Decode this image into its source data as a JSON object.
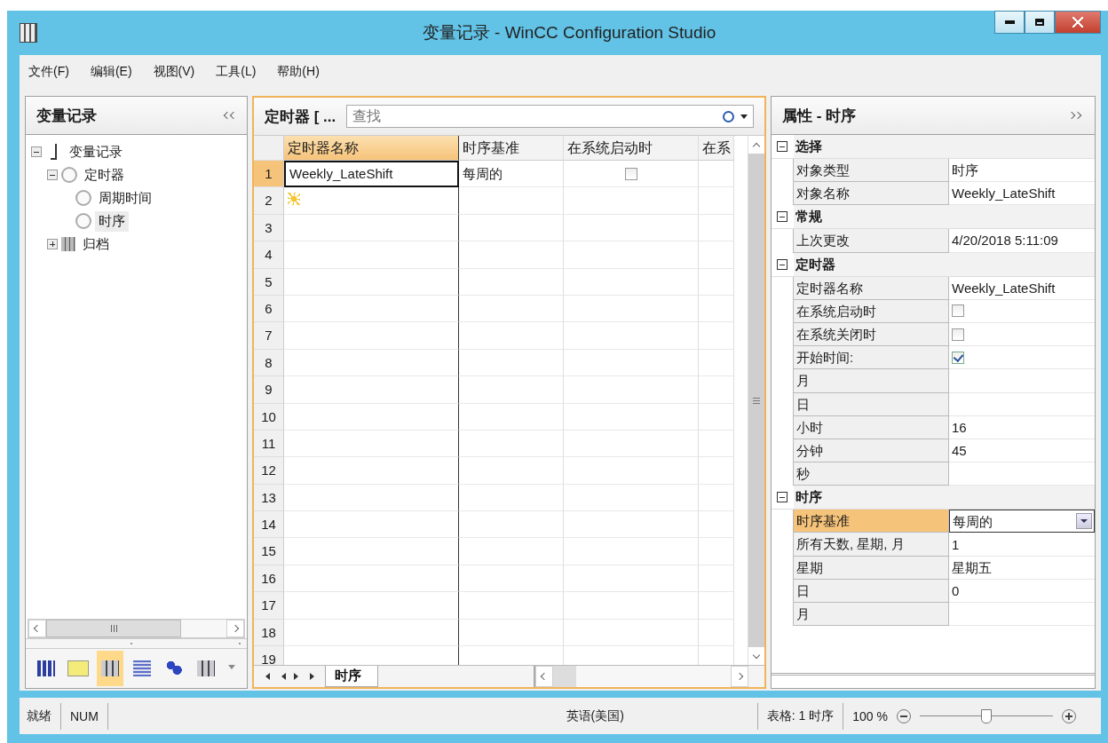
{
  "window": {
    "title": "变量记录 - WinCC Configuration Studio"
  },
  "menu": [
    "文件(F)",
    "编辑(E)",
    "视图(V)",
    "工具(L)",
    "帮助(H)"
  ],
  "navigator": {
    "title": "变量记录",
    "tree": [
      {
        "label": "变量记录",
        "kind": "root",
        "expanded": true,
        "selected": false,
        "children": [
          {
            "label": "定时器",
            "kind": "timer",
            "expanded": true,
            "selected": false,
            "children": [
              {
                "label": "周期时间",
                "kind": "timer",
                "selected": false
              },
              {
                "label": "时序",
                "kind": "timer",
                "selected": true
              }
            ]
          },
          {
            "label": "归档",
            "kind": "archive",
            "expanded": false,
            "selected": false
          }
        ]
      }
    ],
    "bottom_icons": [
      {
        "kind": "columns",
        "selected": false
      },
      {
        "kind": "mail",
        "selected": false
      },
      {
        "kind": "archive",
        "selected": true
      },
      {
        "kind": "table",
        "selected": false
      },
      {
        "kind": "users",
        "selected": false
      },
      {
        "kind": "archive",
        "selected": false
      }
    ]
  },
  "grid": {
    "title": "定时器 [ ...",
    "search": {
      "placeholder": "查找"
    },
    "columns": [
      {
        "label": "定时器名称",
        "selected": true
      },
      {
        "label": "时序基准",
        "selected": false
      },
      {
        "label": "在系统启动时",
        "selected": false
      },
      {
        "label": "在系",
        "selected": false
      }
    ],
    "rows": [
      {
        "number": "1",
        "selected": true,
        "new_row": false,
        "cells": [
          {
            "kind": "text",
            "text": "Weekly_LateShift",
            "focused": true
          },
          {
            "kind": "text",
            "text": "每周的",
            "focused": false
          },
          {
            "kind": "checkbox",
            "checked": false
          }
        ]
      },
      {
        "number": "2",
        "selected": false,
        "new_row": true
      },
      {
        "number": "3",
        "selected": false,
        "new_row": false
      },
      {
        "number": "4",
        "selected": false,
        "new_row": false
      },
      {
        "number": "5",
        "selected": false,
        "new_row": false
      },
      {
        "number": "6",
        "selected": false,
        "new_row": false
      },
      {
        "number": "7",
        "selected": false,
        "new_row": false
      },
      {
        "number": "8",
        "selected": false,
        "new_row": false
      },
      {
        "number": "9",
        "selected": false,
        "new_row": false
      },
      {
        "number": "10",
        "selected": false,
        "new_row": false
      },
      {
        "number": "11",
        "selected": false,
        "new_row": false
      },
      {
        "number": "12",
        "selected": false,
        "new_row": false
      },
      {
        "number": "13",
        "selected": false,
        "new_row": false
      },
      {
        "number": "14",
        "selected": false,
        "new_row": false
      },
      {
        "number": "15",
        "selected": false,
        "new_row": false
      },
      {
        "number": "16",
        "selected": false,
        "new_row": false
      },
      {
        "number": "17",
        "selected": false,
        "new_row": false
      },
      {
        "number": "18",
        "selected": false,
        "new_row": false
      },
      {
        "number": "19",
        "selected": false,
        "new_row": false
      }
    ],
    "sheet_tabs": [
      {
        "label": "时序",
        "selected": true
      }
    ]
  },
  "properties": {
    "title": "属性 - 时序",
    "groups": [
      {
        "name": "选择",
        "expanded": true,
        "rows": [
          {
            "label": "对象类型",
            "kind": "text",
            "value": "时序",
            "selected": false
          },
          {
            "label": "对象名称",
            "kind": "text",
            "value": "Weekly_LateShift",
            "selected": false
          }
        ]
      },
      {
        "name": "常规",
        "expanded": true,
        "rows": [
          {
            "label": "上次更改",
            "kind": "text",
            "value": "4/20/2018 5:11:09",
            "selected": false
          }
        ]
      },
      {
        "name": "定时器",
        "expanded": true,
        "rows": [
          {
            "label": "定时器名称",
            "kind": "text",
            "value": "Weekly_LateShift",
            "selected": false
          },
          {
            "label": "在系统启动时",
            "kind": "checkbox",
            "checked": false,
            "selected": false
          },
          {
            "label": "在系统关闭时",
            "kind": "checkbox",
            "checked": false,
            "selected": false
          },
          {
            "label": "开始时间:",
            "kind": "checkbox",
            "checked": true,
            "selected": false
          },
          {
            "label": "月",
            "kind": "text",
            "selected": false
          },
          {
            "label": "日",
            "kind": "text",
            "selected": false
          },
          {
            "label": "小时",
            "kind": "text",
            "value": "16",
            "selected": false
          },
          {
            "label": "分钟",
            "kind": "text",
            "value": "45",
            "selected": false
          },
          {
            "label": "秒",
            "kind": "text",
            "selected": false
          }
        ]
      },
      {
        "name": "时序",
        "expanded": true,
        "rows": [
          {
            "label": "时序基准",
            "kind": "dropdown",
            "value": "每周的",
            "selected": true
          },
          {
            "label": "所有天数, 星期, 月",
            "kind": "text",
            "value": "1",
            "selected": false
          },
          {
            "label": "星期",
            "kind": "text",
            "value": "星期五",
            "selected": false
          },
          {
            "label": "日",
            "kind": "text",
            "value": "0",
            "selected": false
          },
          {
            "label": "月",
            "kind": "text",
            "selected": false
          }
        ]
      }
    ]
  },
  "status_bar": {
    "state": "就绪",
    "num": "NUM",
    "language": "英语(美国)",
    "table": "表格: 1 时序",
    "zoom": "100 %",
    "zoom_slider": {
      "level": 0.5
    }
  }
}
